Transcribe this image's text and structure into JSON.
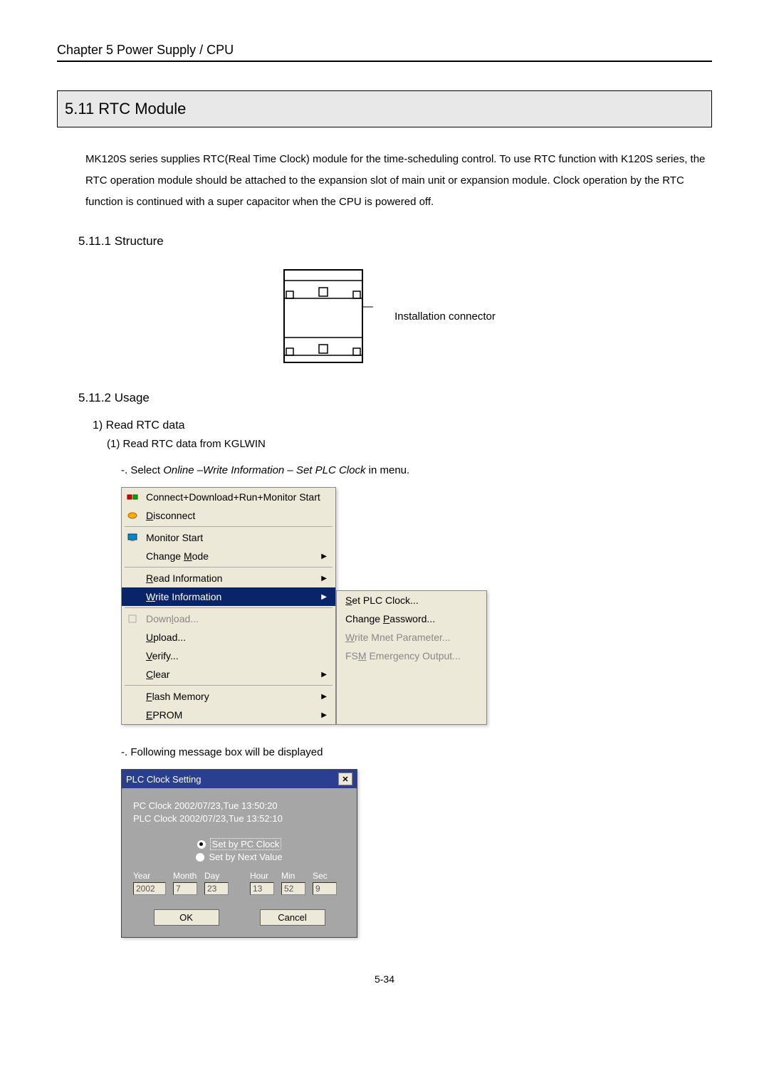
{
  "chapter_header": "Chapter 5    Power Supply / CPU",
  "section_title": "5.11 RTC Module",
  "body_text": "MK120S series supplies RTC(Real Time Clock) module for the time-scheduling control. To use RTC function with K120S series, the RTC operation module should be attached to the expansion slot of main unit or expansion module. Clock operation by the RTC function is continued with a super capacitor when the CPU is powered off.",
  "subsection1": "5.11.1 Structure",
  "diagram_label": "Installation connector",
  "subsection2": "5.11.2 Usage",
  "step1": "1) Read RTC data",
  "substep1": "(1)   Read RTC data from KGLWIN",
  "instruction1_prefix": "-. Select ",
  "instruction1_italic": "Online –Write Information – Set PLC Clock",
  "instruction1_suffix": " in menu.",
  "menu": {
    "item1": "Connect+Download+Run+Monitor Start",
    "item2_u": "D",
    "item2_rest": "isconnect",
    "item3": "Monitor Start",
    "item4_pre": "Change ",
    "item4_u": "M",
    "item4_rest": "ode",
    "item5_u": "R",
    "item5_rest": "ead Information",
    "item6_u": "W",
    "item6_rest": "rite Information",
    "item7_pre": "Down",
    "item7_u": "l",
    "item7_rest": "oad...",
    "item8_u": "U",
    "item8_rest": "pload...",
    "item9_u": "V",
    "item9_rest": "erify...",
    "item10_u": "C",
    "item10_rest": "lear",
    "item11_u": "F",
    "item11_rest": "lash Memory",
    "item12_u": "E",
    "item12_rest": "PROM"
  },
  "submenu": {
    "s1_u": "S",
    "s1_rest": "et PLC Clock...",
    "s2_pre": "Change ",
    "s2_u": "P",
    "s2_rest": "assword...",
    "s3_u": "W",
    "s3_rest": "rite Mnet Parameter...",
    "s4_pre": "FS",
    "s4_u": "M",
    "s4_rest": " Emergency Output..."
  },
  "instruction2": "-. Following message box will be displayed",
  "dialog": {
    "title": "PLC Clock Setting",
    "pc_clock": "PC Clock  2002/07/23,Tue 13:50:20",
    "plc_clock": "PLC Clock 2002/07/23,Tue 13:52:10",
    "radio1": "Set by PC Clock",
    "radio2": "Set by Next Value",
    "labels": {
      "year": "Year",
      "month": "Month",
      "day": "Day",
      "hour": "Hour",
      "min": "Min",
      "sec": "Sec"
    },
    "values": {
      "year": "2002",
      "month": "7",
      "day": "23",
      "hour": "13",
      "min": "52",
      "sec": "9"
    },
    "ok": "OK",
    "cancel": "Cancel"
  },
  "page_number": "5-34"
}
